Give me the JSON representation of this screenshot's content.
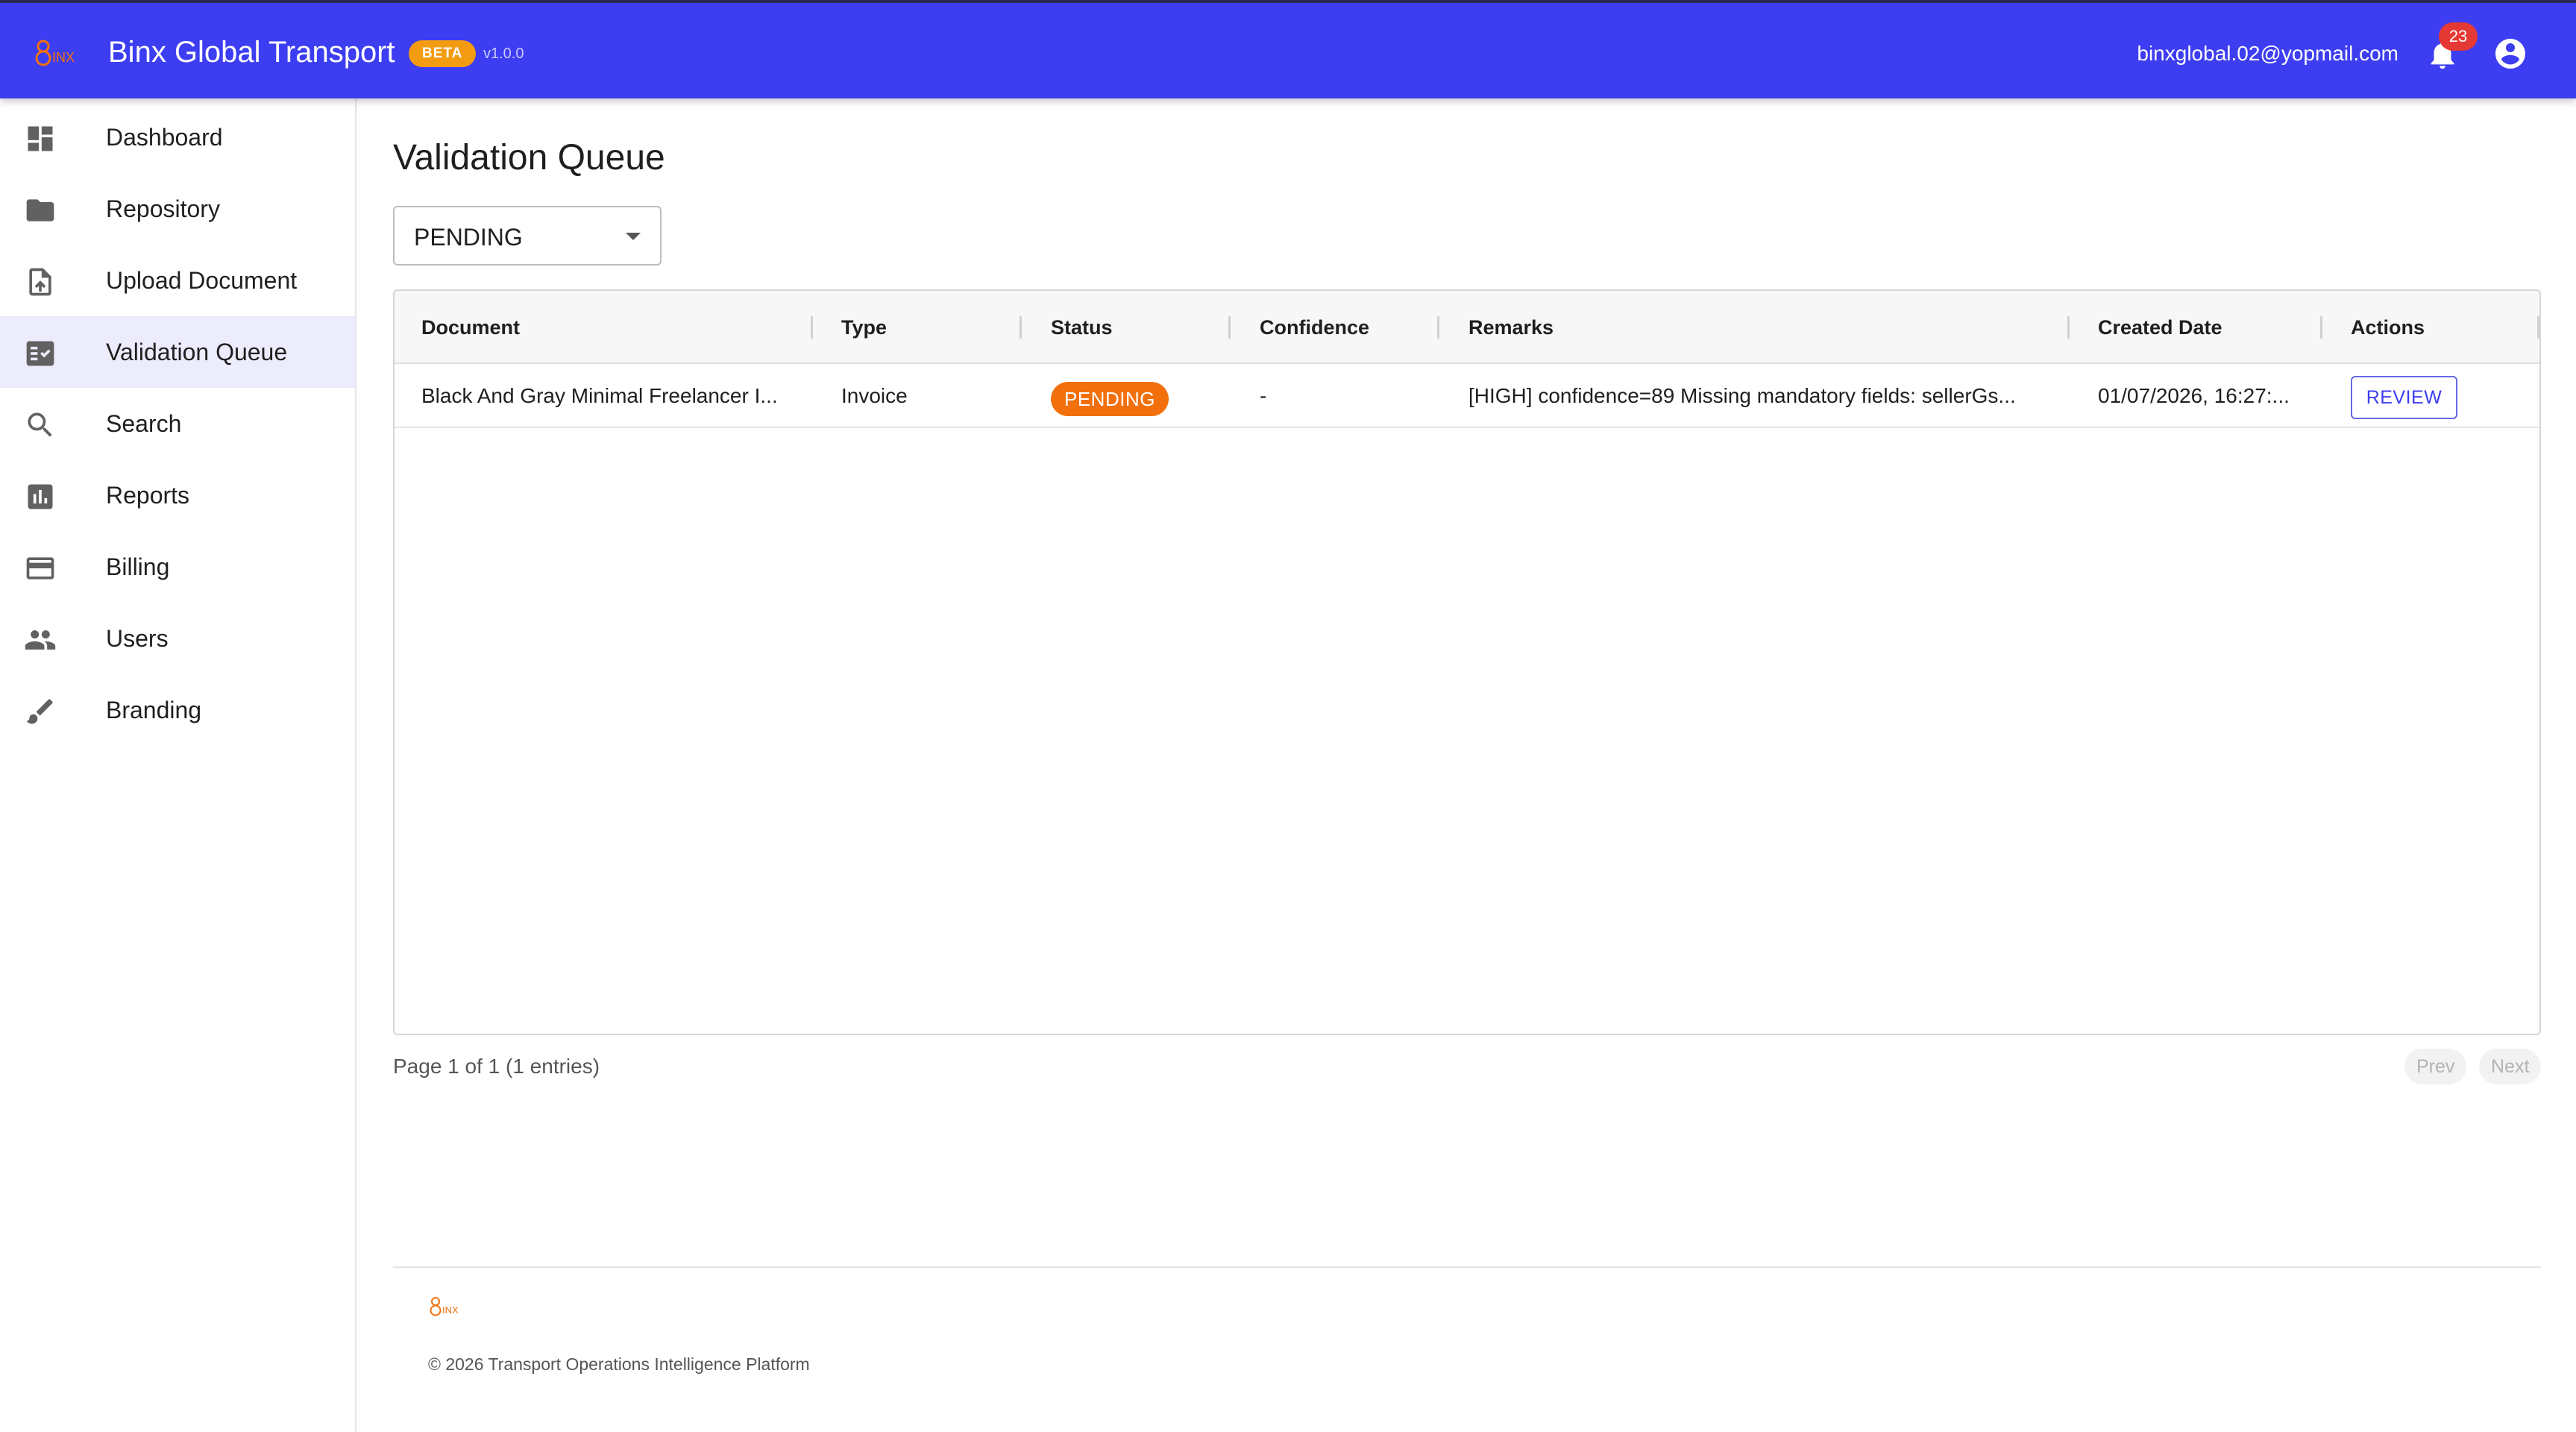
{
  "header": {
    "logo_text": "Binx",
    "app_title": "Binx Global Transport",
    "beta_label": "BETA",
    "version": "v1.0.0",
    "user_email": "binxglobal.02@yopmail.com",
    "notification_count": "23",
    "icons": [
      "binx-logo-icon",
      "bell-icon",
      "account-circle-icon"
    ],
    "colors": {
      "bar": "#3d3df2",
      "beta": "#f39c12",
      "badge": "#e53935",
      "logo": "#f2700b"
    }
  },
  "sidebar": {
    "items": [
      {
        "label": "Dashboard",
        "icon": "dashboard-icon",
        "active": false
      },
      {
        "label": "Repository",
        "icon": "folder-icon",
        "active": false
      },
      {
        "label": "Upload Document",
        "icon": "upload-file-icon",
        "active": false
      },
      {
        "label": "Validation Queue",
        "icon": "fact-check-icon",
        "active": true
      },
      {
        "label": "Search",
        "icon": "search-icon",
        "active": false
      },
      {
        "label": "Reports",
        "icon": "bar-chart-icon",
        "active": false
      },
      {
        "label": "Billing",
        "icon": "credit-card-icon",
        "active": false
      },
      {
        "label": "Users",
        "icon": "people-icon",
        "active": false
      },
      {
        "label": "Branding",
        "icon": "brush-icon",
        "active": false
      }
    ],
    "active_color": "#ececfd"
  },
  "main": {
    "title": "Validation Queue",
    "status_filter": {
      "value": "PENDING",
      "icon": "arrow-drop-down-icon"
    },
    "table": {
      "columns": [
        "Document",
        "Type",
        "Status",
        "Confidence",
        "Remarks",
        "Created Date",
        "Actions"
      ],
      "rows": [
        {
          "document": "Black And Gray Minimal Freelancer I...",
          "type": "Invoice",
          "status": "PENDING",
          "confidence": "-",
          "remarks": "[HIGH] confidence=89 Missing mandatory fields: sellerGs...",
          "created_date": "01/07/2026, 16:27:...",
          "action": "REVIEW"
        }
      ],
      "status_color": "#f2700b"
    },
    "pagination": {
      "info": "Page 1 of 1 (1 entries)",
      "prev": "Prev",
      "next": "Next"
    }
  },
  "footer": {
    "logo_text": "Binx",
    "copyright": "© 2026 Transport Operations Intelligence Platform"
  }
}
